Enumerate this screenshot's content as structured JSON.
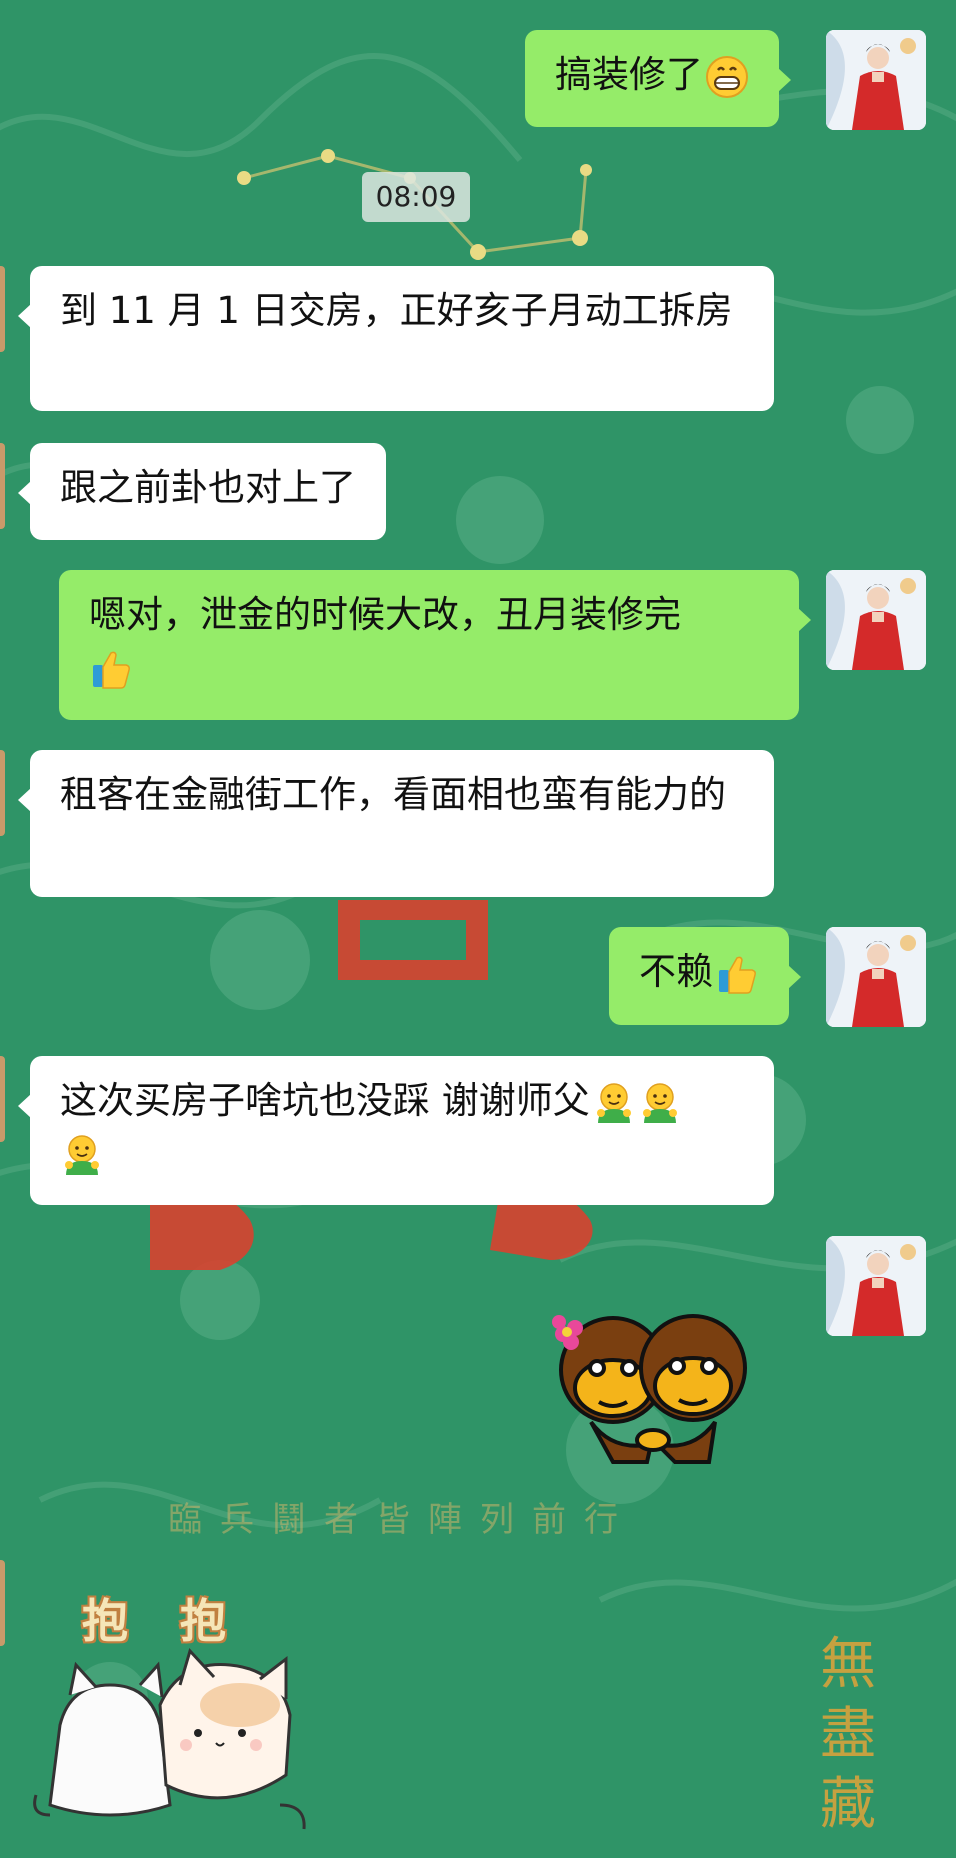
{
  "chat": {
    "timestamp": "08:09",
    "messages": [
      {
        "side": "out",
        "text": "搞装修了",
        "emoji": "grinning-face"
      },
      {
        "side": "in",
        "text": "到 11 月 1 日交房，正好亥子月动工拆房"
      },
      {
        "side": "in",
        "text": "跟之前卦也对上了"
      },
      {
        "side": "out",
        "text": "嗯对，泄金的时候大改，丑月装修完",
        "emoji": "thumbs-up"
      },
      {
        "side": "in",
        "text": "租客在金融街工作，看面相也蛮有能力的"
      },
      {
        "side": "out",
        "text": "不赖",
        "emoji": "thumbs-up"
      },
      {
        "side": "in",
        "text": "这次买房子啥坑也没踩 谢谢师父",
        "emoji": "hugging-face x3"
      },
      {
        "side": "out",
        "sticker": "two-monkeys-holding-hands"
      },
      {
        "side": "in",
        "sticker": "hug-cats",
        "sticker_text": "抱 抱"
      }
    ]
  },
  "background": {
    "color": "#2f9467",
    "text_bottom": "臨兵鬪者皆陣列前行",
    "text_vertical": "無盡藏"
  },
  "colors": {
    "bubble_out": "#95ec69",
    "bubble_in": "#ffffff"
  }
}
